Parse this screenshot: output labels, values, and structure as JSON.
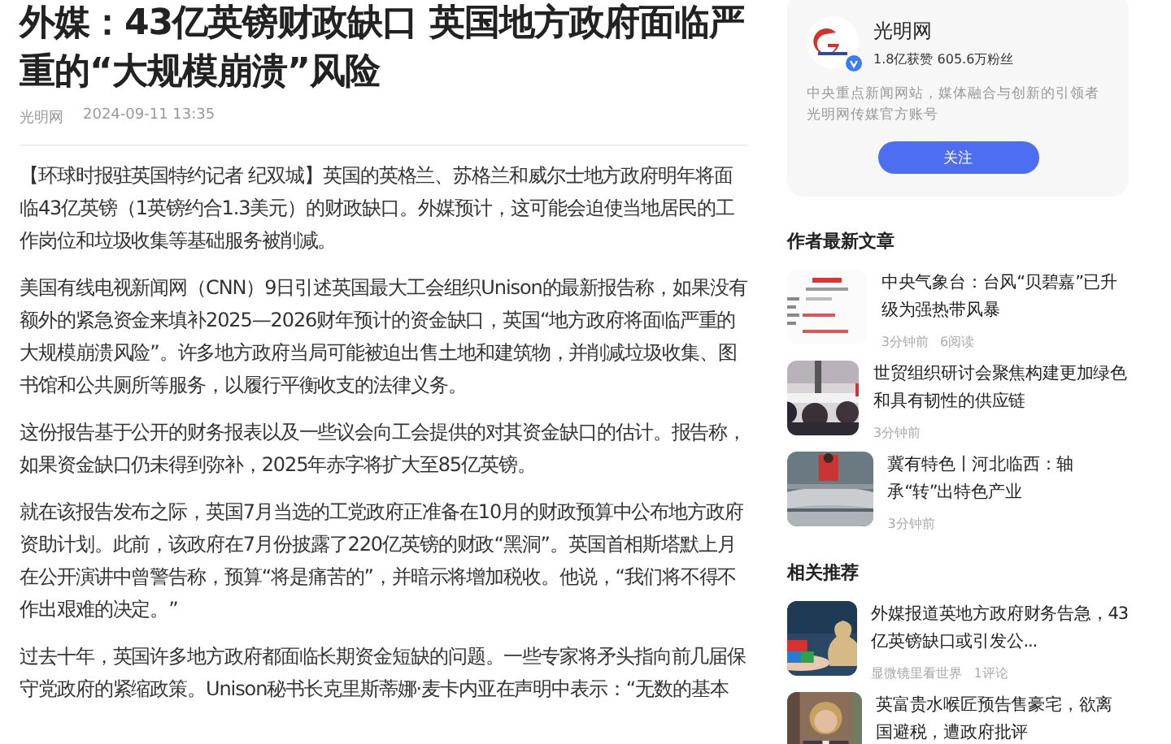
{
  "article": {
    "title": "外媒：43亿英镑财政缺口 英国地方政府面临严重的“大规模崩溃”风险",
    "source": "光明网",
    "date": "2024-09-11 13:35",
    "paragraphs": [
      "【环球时报驻英国特约记者 纪双城】英国的英格兰、苏格兰和威尔士地方政府明年将面临43亿英镑（1英镑约合1.3美元）的财政缺口。外媒预计，这可能会迫使当地居民的工作岗位和垃圾收集等基础服务被削减。",
      "美国有线电视新闻网（CNN）9日引述英国最大工会组织Unison的最新报告称，如果没有额外的紧急资金来填补2025—2026财年预计的资金缺口，英国“地方政府将面临严重的大规模崩溃风险”。许多地方政府当局可能被迫出售土地和建筑物，并削减垃圾收集、图书馆和公共厕所等服务，以履行平衡收支的法律义务。",
      "这份报告基于公开的财务报表以及一些议会向工会提供的对其资金缺口的估计。报告称，如果资金缺口仍未得到弥补，2025年赤字将扩大至85亿英镑。",
      "就在该报告发布之际，英国7月当选的工党政府正准备在10月的财政预算中公布地方政府资助计划。此前，该政府在7月份披露了220亿英镑的财政“黑洞”。英国首相斯塔默上月在公开演讲中曾警告称，预算“将是痛苦的”，并暗示将增加税收。他说，“我们将不得不作出艰难的决定。”",
      "过去十年，英国许多地方政府都面临长期资金短缺的问题。一些专家将矛头指向前几届保守党政府的紧缩政策。Unison秘书长克里斯蒂娜·麦卡内亚在声明中表示：“无数的基本"
    ]
  },
  "author_card": {
    "name": "光明网",
    "verified": true,
    "stats": "1.8亿获赞 605.6万粉丝",
    "description": [
      "中央重点新闻网站，媒体融合与创新的引领者",
      "光明网传媒官方账号"
    ],
    "follow_button": "关注"
  },
  "latest_articles": {
    "heading": "作者最新文章",
    "items": [
      {
        "kind": "picture",
        "title": "中央气象台：台风“贝碧嘉”已升级为强热带风暴",
        "time": "3分钟前",
        "reads": "6阅读"
      },
      {
        "kind": "picture",
        "title": "世贸组织研讨会聚焦构建更加绿色和具有韧性的供应链",
        "time": "3分钟前"
      },
      {
        "kind": "picture",
        "title": "冀有特色丨河北临西：轴承“转”出特色产业",
        "time": "3分钟前"
      }
    ]
  },
  "related": {
    "heading": "相关推荐",
    "items": [
      {
        "kind": "picture",
        "title": "外媒报道英地方政府财务告急，43亿英镑缺口或引发公...",
        "source": "显微镜里看世界",
        "comments": "1评论"
      },
      {
        "kind": "picture",
        "title": "英富贵水喉匠预告售豪宅，欲离国避税，遭政府批评"
      }
    ]
  }
}
